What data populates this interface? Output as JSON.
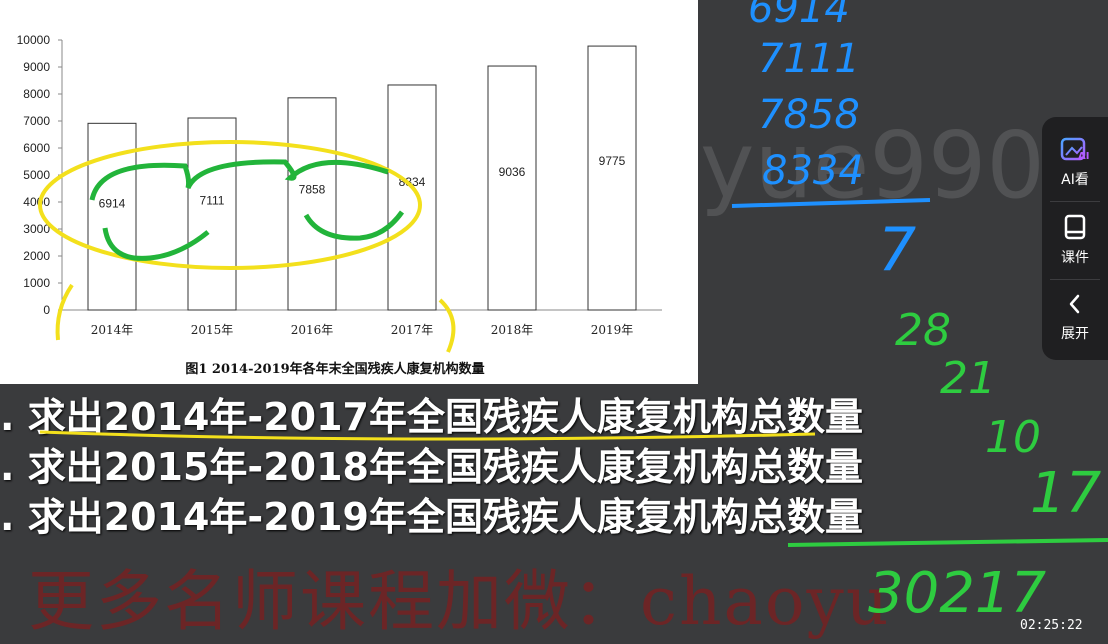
{
  "chart_data": {
    "type": "bar",
    "title": "图1 2014-2019年各年末全国残疾人康复机构数量",
    "categories": [
      "2014年",
      "2015年",
      "2016年",
      "2017年",
      "2018年",
      "2019年"
    ],
    "values": [
      6914,
      7111,
      7858,
      8334,
      9036,
      9775
    ],
    "ylim": [
      0,
      10000
    ],
    "yticks": [
      0,
      1000,
      2000,
      3000,
      4000,
      5000,
      6000,
      7000,
      8000,
      9000,
      10000
    ],
    "grid": false,
    "bar_color": "#ffffff",
    "bar_stroke": "#333333"
  },
  "questions": [
    ". 求出2014年-2017年全国残疾人康复机构总数量",
    ". 求出2015年-2018年全国残疾人康复机构总数量",
    ". 求出2014年-2019年全国残疾人康复机构总数量"
  ],
  "watermark_bg": "yue9901",
  "watermark_bottom": "更多名师课程加微：chaoyu",
  "sidebar": {
    "items": [
      {
        "label": "AI看",
        "icon": "ai-image-icon"
      },
      {
        "label": "课件",
        "icon": "book-icon"
      },
      {
        "label": "展开",
        "icon": "chevron-left-icon"
      }
    ]
  },
  "handwriting": {
    "blue_numbers": [
      "6914",
      "7111",
      "7858",
      "8334",
      "7"
    ],
    "green_numbers": [
      "28",
      "21",
      "10",
      "17",
      "30217"
    ]
  },
  "timestamp": "02:25:22",
  "colors": {
    "background": "#3a3b3d",
    "yellow_annotation": "#f3e01c",
    "green_annotation": "#2ecc40",
    "blue_annotation": "#1e90ff",
    "sidebar_bg": "#1f1f21"
  }
}
